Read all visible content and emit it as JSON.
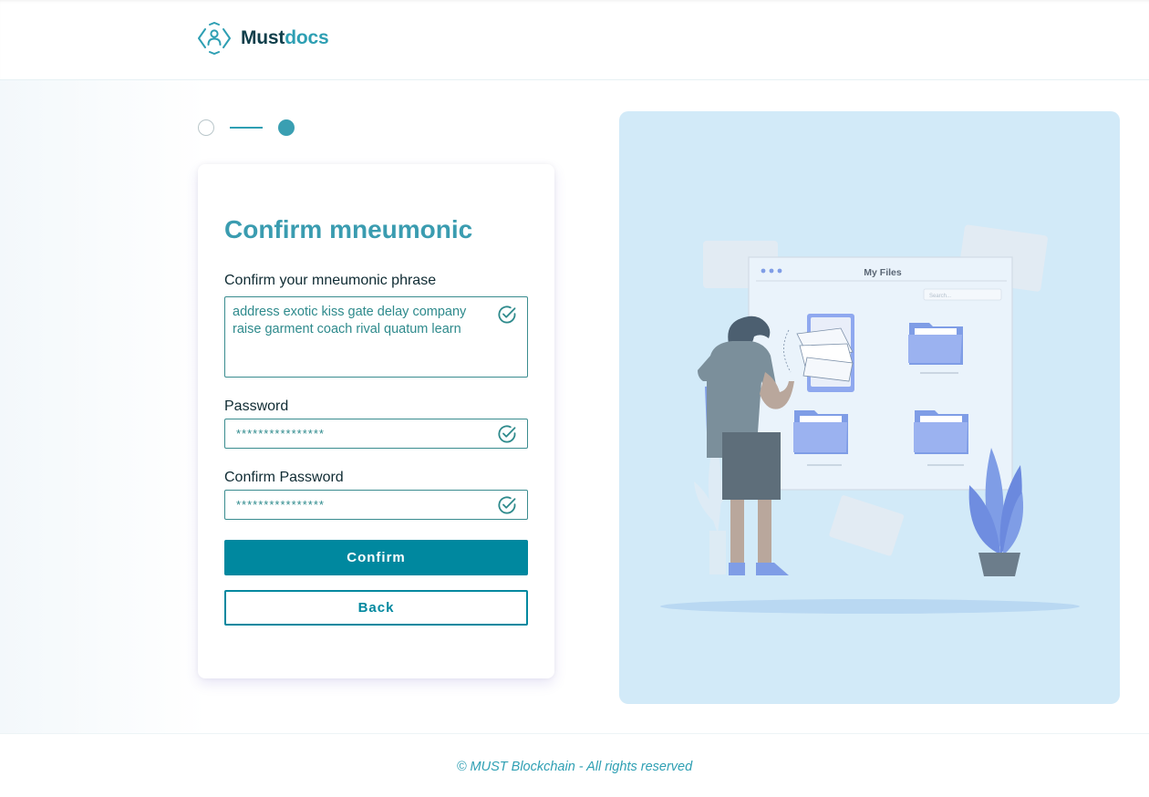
{
  "brand": {
    "name_part1": "Must",
    "name_part2": "docs",
    "logo_icon": "user-hexagon-icon"
  },
  "stepper": {
    "current_step": 2,
    "total_steps": 2
  },
  "form": {
    "title": "Confirm mneumonic",
    "mnemonic_label": "Confirm your mneumonic phrase",
    "mnemonic_value": "address exotic kiss gate delay company raise garment coach rival quatum learn",
    "password_label": "Password",
    "password_value": "****************",
    "confirm_password_label": "Confirm Password",
    "confirm_password_value": "****************",
    "confirm_button": "Confirm",
    "back_button": "Back",
    "valid_icon": "check-circle-icon"
  },
  "illustration": {
    "window_title": "My  Files",
    "search_placeholder": "Search..."
  },
  "footer": {
    "text": "© MUST Blockchain - All rights reserved"
  },
  "colors": {
    "accent": "#00889f",
    "title": "#3a9cb0",
    "field_border": "#3a8c8f",
    "illustration_bg": "#d2eaf8",
    "folder": "#8fa8ef"
  }
}
